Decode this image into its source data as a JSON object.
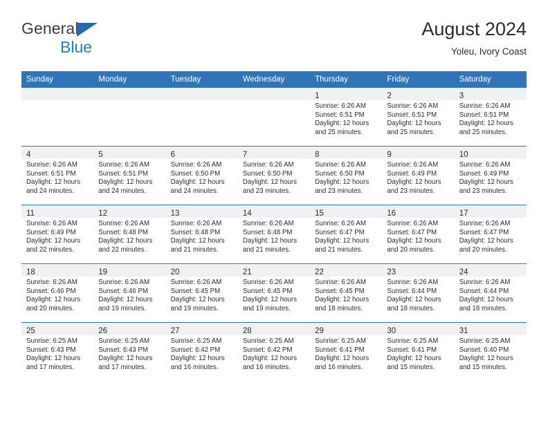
{
  "brand": {
    "line1": "General",
    "line2": "Blue",
    "triangle_color": "#1d6cb5",
    "blue_text_color": "#1d7fd4"
  },
  "header": {
    "title": "August 2024",
    "subtitle": "Yoleu, Ivory Coast",
    "accent_color": "#3075b8"
  },
  "weekdays": [
    "Sunday",
    "Monday",
    "Tuesday",
    "Wednesday",
    "Thursday",
    "Friday",
    "Saturday"
  ],
  "weeks": [
    {
      "shaded": true,
      "days": [
        {
          "num": "",
          "lines": []
        },
        {
          "num": "",
          "lines": []
        },
        {
          "num": "",
          "lines": []
        },
        {
          "num": "",
          "lines": []
        },
        {
          "num": "1",
          "lines": [
            "Sunrise: 6:26 AM",
            "Sunset: 6:51 PM",
            "Daylight: 12 hours",
            "and 25 minutes."
          ]
        },
        {
          "num": "2",
          "lines": [
            "Sunrise: 6:26 AM",
            "Sunset: 6:51 PM",
            "Daylight: 12 hours",
            "and 25 minutes."
          ]
        },
        {
          "num": "3",
          "lines": [
            "Sunrise: 6:26 AM",
            "Sunset: 6:51 PM",
            "Daylight: 12 hours",
            "and 25 minutes."
          ]
        }
      ]
    },
    {
      "shaded": true,
      "days": [
        {
          "num": "4",
          "lines": [
            "Sunrise: 6:26 AM",
            "Sunset: 6:51 PM",
            "Daylight: 12 hours",
            "and 24 minutes."
          ]
        },
        {
          "num": "5",
          "lines": [
            "Sunrise: 6:26 AM",
            "Sunset: 6:51 PM",
            "Daylight: 12 hours",
            "and 24 minutes."
          ]
        },
        {
          "num": "6",
          "lines": [
            "Sunrise: 6:26 AM",
            "Sunset: 6:50 PM",
            "Daylight: 12 hours",
            "and 24 minutes."
          ]
        },
        {
          "num": "7",
          "lines": [
            "Sunrise: 6:26 AM",
            "Sunset: 6:50 PM",
            "Daylight: 12 hours",
            "and 23 minutes."
          ]
        },
        {
          "num": "8",
          "lines": [
            "Sunrise: 6:26 AM",
            "Sunset: 6:50 PM",
            "Daylight: 12 hours",
            "and 23 minutes."
          ]
        },
        {
          "num": "9",
          "lines": [
            "Sunrise: 6:26 AM",
            "Sunset: 6:49 PM",
            "Daylight: 12 hours",
            "and 23 minutes."
          ]
        },
        {
          "num": "10",
          "lines": [
            "Sunrise: 6:26 AM",
            "Sunset: 6:49 PM",
            "Daylight: 12 hours",
            "and 23 minutes."
          ]
        }
      ]
    },
    {
      "shaded": true,
      "days": [
        {
          "num": "11",
          "lines": [
            "Sunrise: 6:26 AM",
            "Sunset: 6:49 PM",
            "Daylight: 12 hours",
            "and 22 minutes."
          ]
        },
        {
          "num": "12",
          "lines": [
            "Sunrise: 6:26 AM",
            "Sunset: 6:48 PM",
            "Daylight: 12 hours",
            "and 22 minutes."
          ]
        },
        {
          "num": "13",
          "lines": [
            "Sunrise: 6:26 AM",
            "Sunset: 6:48 PM",
            "Daylight: 12 hours",
            "and 21 minutes."
          ]
        },
        {
          "num": "14",
          "lines": [
            "Sunrise: 6:26 AM",
            "Sunset: 6:48 PM",
            "Daylight: 12 hours",
            "and 21 minutes."
          ]
        },
        {
          "num": "15",
          "lines": [
            "Sunrise: 6:26 AM",
            "Sunset: 6:47 PM",
            "Daylight: 12 hours",
            "and 21 minutes."
          ]
        },
        {
          "num": "16",
          "lines": [
            "Sunrise: 6:26 AM",
            "Sunset: 6:47 PM",
            "Daylight: 12 hours",
            "and 20 minutes."
          ]
        },
        {
          "num": "17",
          "lines": [
            "Sunrise: 6:26 AM",
            "Sunset: 6:47 PM",
            "Daylight: 12 hours",
            "and 20 minutes."
          ]
        }
      ]
    },
    {
      "shaded": true,
      "days": [
        {
          "num": "18",
          "lines": [
            "Sunrise: 6:26 AM",
            "Sunset: 6:46 PM",
            "Daylight: 12 hours",
            "and 20 minutes."
          ]
        },
        {
          "num": "19",
          "lines": [
            "Sunrise: 6:26 AM",
            "Sunset: 6:46 PM",
            "Daylight: 12 hours",
            "and 19 minutes."
          ]
        },
        {
          "num": "20",
          "lines": [
            "Sunrise: 6:26 AM",
            "Sunset: 6:45 PM",
            "Daylight: 12 hours",
            "and 19 minutes."
          ]
        },
        {
          "num": "21",
          "lines": [
            "Sunrise: 6:26 AM",
            "Sunset: 6:45 PM",
            "Daylight: 12 hours",
            "and 19 minutes."
          ]
        },
        {
          "num": "22",
          "lines": [
            "Sunrise: 6:26 AM",
            "Sunset: 6:45 PM",
            "Daylight: 12 hours",
            "and 18 minutes."
          ]
        },
        {
          "num": "23",
          "lines": [
            "Sunrise: 6:26 AM",
            "Sunset: 6:44 PM",
            "Daylight: 12 hours",
            "and 18 minutes."
          ]
        },
        {
          "num": "24",
          "lines": [
            "Sunrise: 6:26 AM",
            "Sunset: 6:44 PM",
            "Daylight: 12 hours",
            "and 18 minutes."
          ]
        }
      ]
    },
    {
      "shaded": true,
      "days": [
        {
          "num": "25",
          "lines": [
            "Sunrise: 6:25 AM",
            "Sunset: 6:43 PM",
            "Daylight: 12 hours",
            "and 17 minutes."
          ]
        },
        {
          "num": "26",
          "lines": [
            "Sunrise: 6:25 AM",
            "Sunset: 6:43 PM",
            "Daylight: 12 hours",
            "and 17 minutes."
          ]
        },
        {
          "num": "27",
          "lines": [
            "Sunrise: 6:25 AM",
            "Sunset: 6:42 PM",
            "Daylight: 12 hours",
            "and 16 minutes."
          ]
        },
        {
          "num": "28",
          "lines": [
            "Sunrise: 6:25 AM",
            "Sunset: 6:42 PM",
            "Daylight: 12 hours",
            "and 16 minutes."
          ]
        },
        {
          "num": "29",
          "lines": [
            "Sunrise: 6:25 AM",
            "Sunset: 6:41 PM",
            "Daylight: 12 hours",
            "and 16 minutes."
          ]
        },
        {
          "num": "30",
          "lines": [
            "Sunrise: 6:25 AM",
            "Sunset: 6:41 PM",
            "Daylight: 12 hours",
            "and 15 minutes."
          ]
        },
        {
          "num": "31",
          "lines": [
            "Sunrise: 6:25 AM",
            "Sunset: 6:40 PM",
            "Daylight: 12 hours",
            "and 15 minutes."
          ]
        }
      ]
    }
  ]
}
